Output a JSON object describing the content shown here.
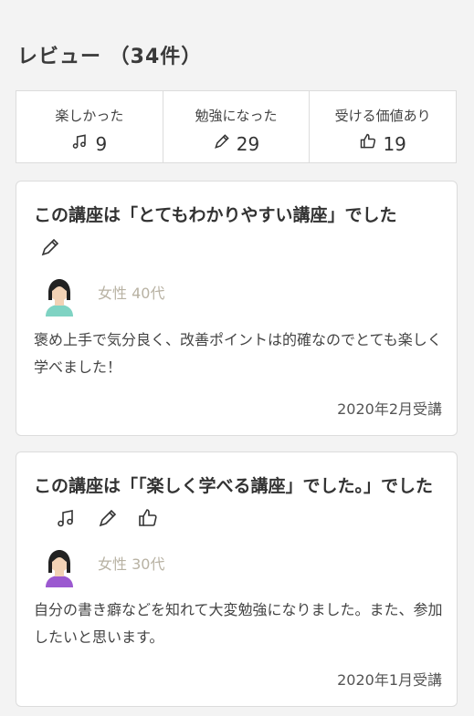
{
  "header": {
    "title": "レビュー （34件）"
  },
  "stats": [
    {
      "label": "楽しかった",
      "icon": "music-note-icon",
      "value": "9"
    },
    {
      "label": "勉強になった",
      "icon": "pencil-icon",
      "value": "29"
    },
    {
      "label": "受ける価値あり",
      "icon": "thumbs-up-icon",
      "value": "19"
    }
  ],
  "reviews": [
    {
      "title": "この講座は「とてもわかりやすい講座」でした",
      "icons": [
        "pencil-icon"
      ],
      "user": "女性 40代",
      "body": "褒め上手で気分良く、改善ポイントは的確なのでとても楽しく学べました！",
      "date": "2020年2月受講"
    },
    {
      "title": "この講座は「「楽しく学べる講座」でした。」でした",
      "icons": [
        "music-note-icon",
        "pencil-icon",
        "thumbs-up-icon"
      ],
      "user": "女性 30代",
      "body": "自分の書き癖などを知れて大変勉強になりました。また、参加したいと思います。",
      "date": "2020年1月受講"
    }
  ],
  "colors": {
    "accent_text": "#b8b2a3",
    "avatar2_shirt": "#9b59d0",
    "avatar1_shirt": "#7fd3c3"
  }
}
